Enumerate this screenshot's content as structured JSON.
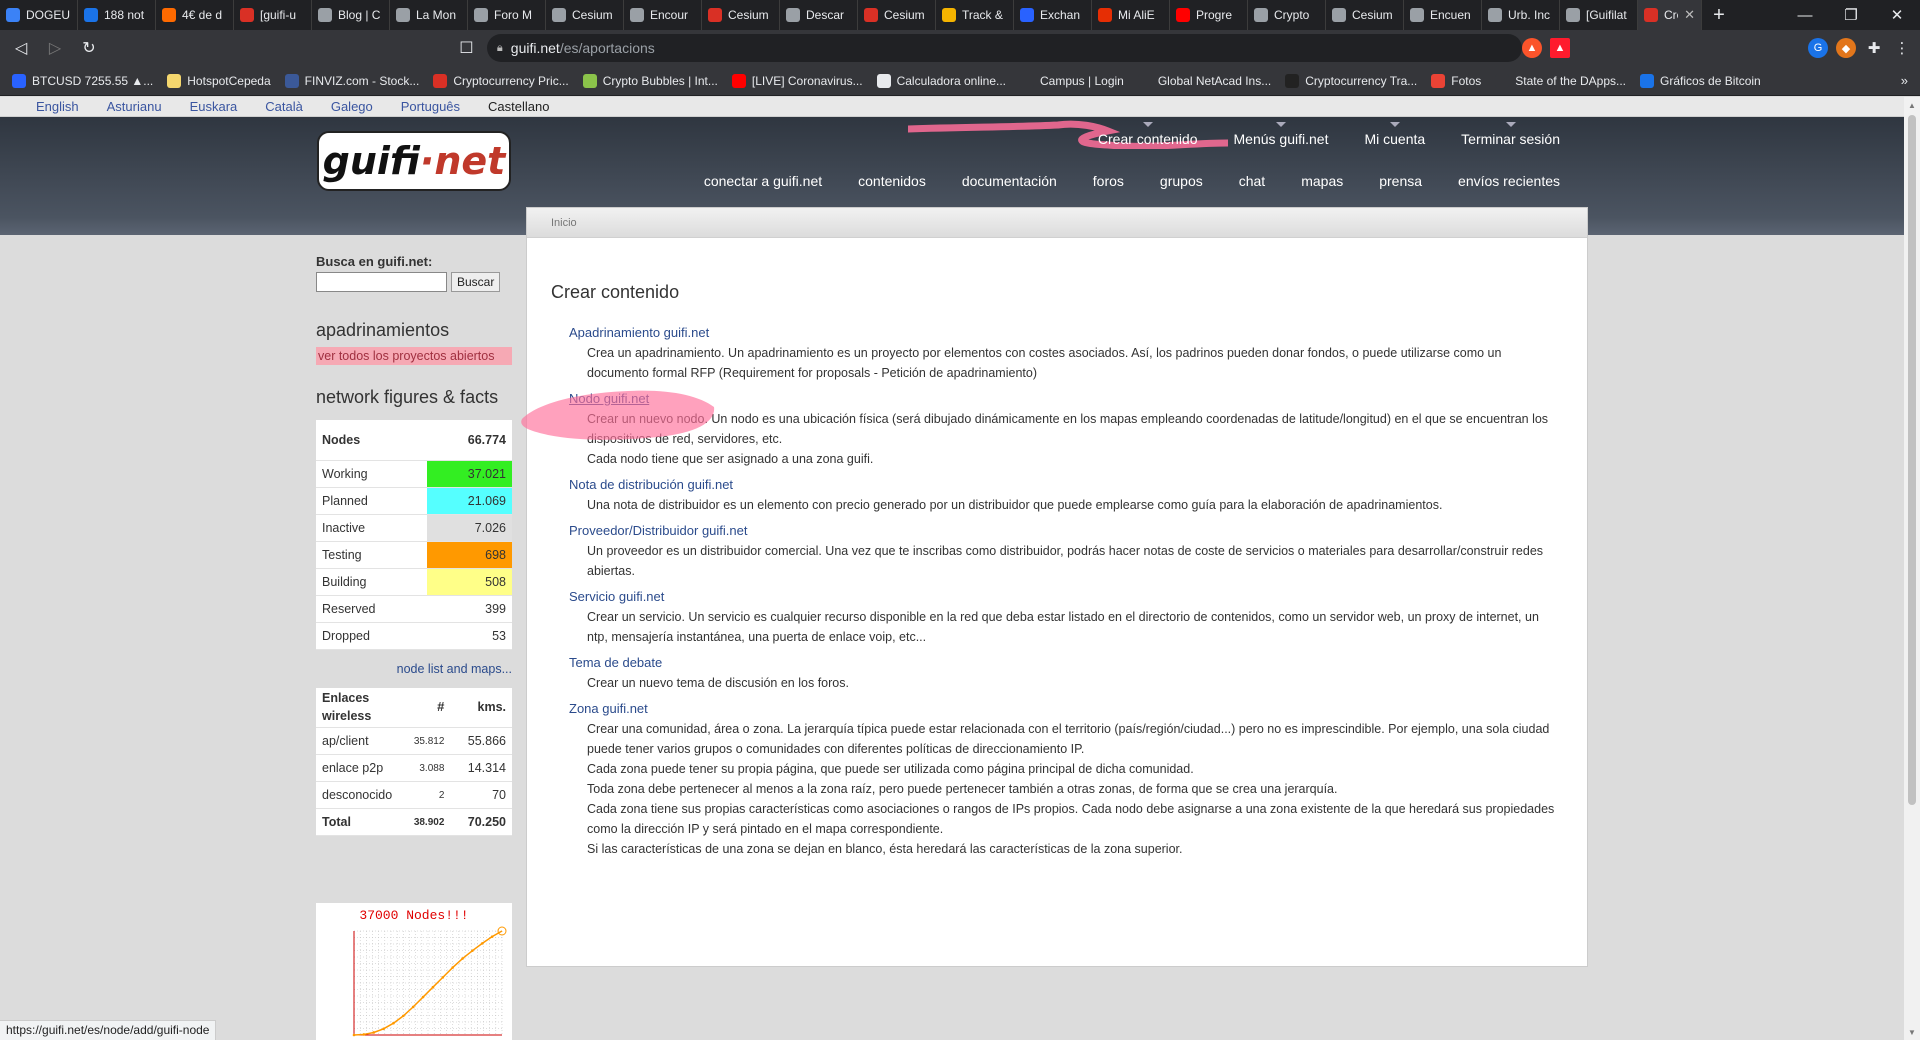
{
  "browser": {
    "tabs": [
      {
        "title": "DOGEU",
        "color": "#3b82f6"
      },
      {
        "title": "188 not",
        "color": "#1a73e8"
      },
      {
        "title": "4€ de d",
        "color": "#ff6a00"
      },
      {
        "title": "[guifi-u",
        "color": "#d93025"
      },
      {
        "title": "Blog | C",
        "color": "#9aa0a6"
      },
      {
        "title": "La Mon",
        "color": "#9aa0a6"
      },
      {
        "title": "Foro M",
        "color": "#9aa0a6"
      },
      {
        "title": "Cesium",
        "color": "#9aa0a6"
      },
      {
        "title": "Encour",
        "color": "#9aa0a6"
      },
      {
        "title": "Cesium",
        "color": "#d93025"
      },
      {
        "title": "Descar",
        "color": "#9aa0a6"
      },
      {
        "title": "Cesium",
        "color": "#d93025"
      },
      {
        "title": "Track &",
        "color": "#f5b400"
      },
      {
        "title": "Exchan",
        "color": "#2962ff"
      },
      {
        "title": "Mi AliE",
        "color": "#e62e04"
      },
      {
        "title": "Progre",
        "color": "#ff0000"
      },
      {
        "title": "Crypto",
        "color": "#9aa0a6"
      },
      {
        "title": "Cesium",
        "color": "#9aa0a6"
      },
      {
        "title": "Encuen",
        "color": "#9aa0a6"
      },
      {
        "title": "Urb. Inc",
        "color": "#9aa0a6"
      },
      {
        "title": "[Guifilat",
        "color": "#9aa0a6"
      },
      {
        "title": "Crea",
        "color": "#d93025",
        "active": true
      }
    ],
    "url_host": "guifi.net",
    "url_path": "/es/aportacions",
    "bookmarks": [
      {
        "label": "BTCUSD 7255.55 ▲...",
        "color": "#2962ff"
      },
      {
        "label": "HotspotCepeda",
        "color": "#f5d76e"
      },
      {
        "label": "FINVIZ.com - Stock...",
        "color": "#3b5998"
      },
      {
        "label": "Cryptocurrency Pric...",
        "color": "#d93025"
      },
      {
        "label": "Crypto Bubbles | Int...",
        "color": "#8bc34a"
      },
      {
        "label": "[LIVE] Coronavirus...",
        "color": "#ff0000"
      },
      {
        "label": "Calculadora online...",
        "color": "#e8eaed"
      },
      {
        "label": "Campus | Login",
        "color": "#35363a"
      },
      {
        "label": "Global NetAcad Ins...",
        "color": "#35363a"
      },
      {
        "label": "Cryptocurrency Tra...",
        "color": "#222"
      },
      {
        "label": "Fotos",
        "color": "#ea4335"
      },
      {
        "label": "State of the DApps...",
        "color": "#35363a"
      },
      {
        "label": "Gráficos de Bitcoin",
        "color": "#1a73e8"
      }
    ]
  },
  "languages": [
    "English",
    "Asturianu",
    "Euskara",
    "Català",
    "Galego",
    "Português",
    "Castellano"
  ],
  "header": {
    "logo": {
      "left": "guifi",
      "dot": "·",
      "right": "net"
    },
    "user_menu": [
      "Crear contenido",
      "Menús guifi.net",
      "Mi cuenta",
      "Terminar sesión"
    ],
    "primary_nav": [
      "conectar a guifi.net",
      "contenidos",
      "documentación",
      "foros",
      "grupos",
      "chat",
      "mapas",
      "prensa",
      "envíos recientes"
    ]
  },
  "breadcrumb": "Inicio",
  "page_title": "Crear contenido",
  "content_types": [
    {
      "name": "Apadrinamiento guifi.net",
      "desc": [
        "Crea un apadrinamiento. Un apadrinamiento es un proyecto por elementos con costes asociados. Así, los padrinos pueden donar fondos, o puede utilizarse como un documento formal RFP (Requirement for proposals - Petición de apadrinamiento)"
      ]
    },
    {
      "name": "Nodo guifi.net",
      "hovered": true,
      "desc": [
        "Crear un nuevo nodo. Un nodo es una ubicación física (será dibujado dinámicamente en los mapas empleando coordenadas de latitude/longitud) en el que se encuentran los dispositivos de red, servidores, etc.",
        "Cada nodo tiene que ser asignado a una zona guifi."
      ]
    },
    {
      "name": "Nota de distribución guifi.net",
      "desc": [
        "Una nota de distribuidor es un elemento con precio generado por un distribuidor que puede emplearse como guía para la elaboración de apadrinamientos."
      ]
    },
    {
      "name": "Proveedor/Distribuidor guifi.net",
      "desc": [
        "Un proveedor es un distribuidor comercial. Una vez que te inscribas como distribuidor, podrás hacer notas de coste de servicios o materiales para desarrollar/construir redes abiertas."
      ]
    },
    {
      "name": "Servicio guifi.net",
      "desc": [
        "Crear un servicio. Un servicio es cualquier recurso disponible en la red que deba estar listado en el directorio de contenidos, como un servidor web, un proxy de internet, un ntp, mensajería instantánea, una puerta de enlace voip, etc..."
      ]
    },
    {
      "name": "Tema de debate",
      "desc": [
        "Crear un nuevo tema de discusión en los foros."
      ]
    },
    {
      "name": "Zona guifi.net",
      "desc": [
        "Crear una comunidad, área o zona. La jerarquía típica puede estar relacionada con el territorio (país/región/ciudad...) pero no es imprescindible. Por ejemplo, una sola ciudad puede tener varios grupos o comunidades con diferentes políticas de direccionamiento IP.",
        "Cada zona puede tener su propia página, que puede ser utilizada como página principal de dicha comunidad.",
        "Toda zona debe pertenecer al menos a la zona raíz, pero puede pertenecer también a otras zonas, de forma que se crea una jerarquía.",
        "Cada zona tiene sus propias características como asociaciones o rangos de IPs propios. Cada nodo debe asignarse a una zona existente de la que heredará sus propiedades como la dirección IP y será pintado en el mapa correspondiente.",
        "Si las características de una zona se dejan en blanco, ésta heredará las características de la zona superior."
      ]
    }
  ],
  "sidebar": {
    "search_label": "Busca en guifi.net:",
    "search_button": "Buscar",
    "sponsor_heading": "apadrinamientos",
    "sponsor_link": "ver todos los proyectos abiertos",
    "figures_heading": "network figures & facts",
    "nodes_label": "Nodes",
    "nodes_total": "66.774",
    "node_stats": [
      {
        "label": "Working",
        "value": "37.021",
        "color": "#33ee22"
      },
      {
        "label": "Planned",
        "value": "21.069",
        "color": "#55ffff"
      },
      {
        "label": "Inactive",
        "value": "7.026",
        "color": "#e0e0e0"
      },
      {
        "label": "Testing",
        "value": "698",
        "color": "#ff9900"
      },
      {
        "label": "Building",
        "value": "508",
        "color": "#ffff88"
      },
      {
        "label": "Reserved",
        "value": "399",
        "color": "#ffffff"
      },
      {
        "label": "Dropped",
        "value": "53",
        "color": "#ffffff"
      }
    ],
    "node_list_link": "node list and maps...",
    "links_head": {
      "label": "Enlaces wireless",
      "count": "#",
      "kms": "kms."
    },
    "links": [
      {
        "label": "ap/client",
        "count": "35.812",
        "kms": "55.866"
      },
      {
        "label": "enlace p2p",
        "count": "3.088",
        "kms": "14.314"
      },
      {
        "label": "desconocido",
        "count": "2",
        "kms": "70"
      }
    ],
    "links_total": {
      "label": "Total",
      "count": "38.902",
      "kms": "70.250"
    }
  },
  "chart_data": {
    "type": "line",
    "title": "37000 Nodes!!!",
    "series": [
      {
        "values": [
          0,
          200,
          900,
          2200,
          4200,
          6800,
          10000,
          13500,
          17000,
          20500,
          24000,
          27200,
          30000,
          32600,
          35000,
          37000
        ]
      }
    ],
    "ylim": [
      0,
      37000
    ],
    "grid": true
  },
  "status_url": "https://guifi.net/es/node/add/guifi-node",
  "colors": {
    "link": "#2b4b8c",
    "pink_highlight": "#f6a9b4"
  }
}
